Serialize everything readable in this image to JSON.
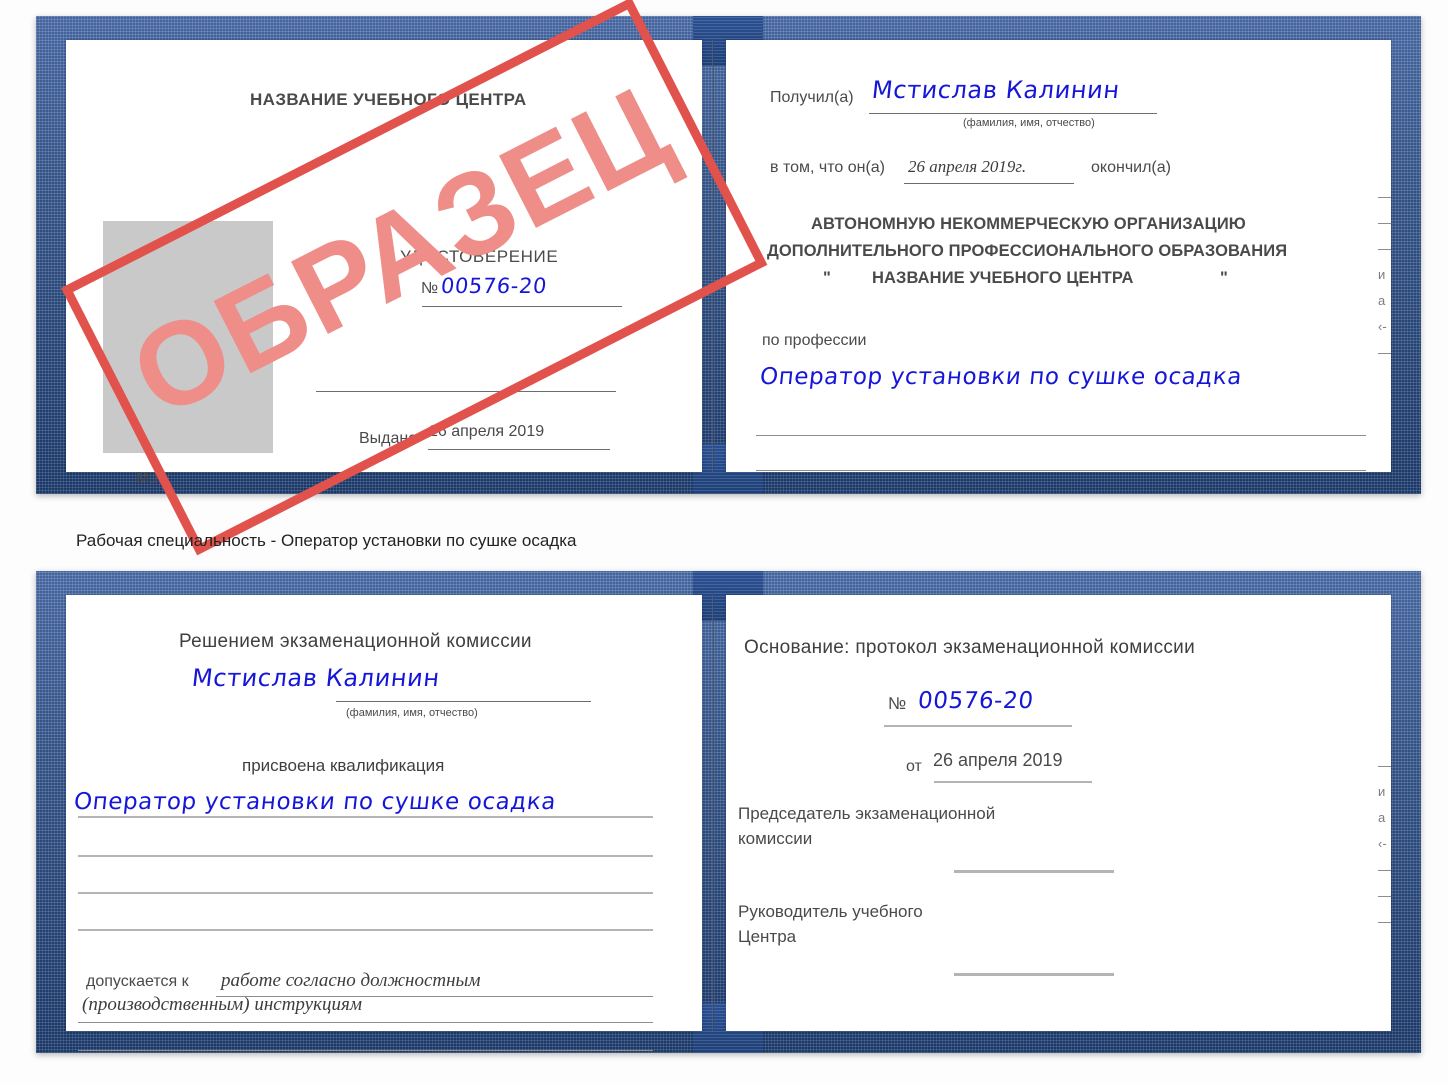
{
  "document": {
    "kind": "Удостоверение",
    "caption": "Рабочая специальность - Оператор установки по сушке осадка",
    "sample_stamp": "ОБРАЗЕЦ",
    "colors": {
      "cover_blue": "#21457f",
      "stamp_red": "#e2524d",
      "stamp_fill": "#ef8d88",
      "handwriting_blue": "#1616d8",
      "photo_placeholder": "#c9c9c9"
    }
  },
  "certificate_top": {
    "left_page": {
      "center_name": "НАЗВАНИЕ УЧЕБНОГО ЦЕНТРА",
      "title": "УДОСТОВЕРЕНИЕ",
      "number_label": "№",
      "number_value": "00576-20",
      "issued_label": "Выдано",
      "issued_value": "26 апреля 2019",
      "seal_label": "М.П."
    },
    "right_page": {
      "received_label": "Получил(а)",
      "received_value": "Мстислав Калинин",
      "received_hint": "(фамилия, имя, отчество)",
      "that_he_label": "в том, что он(а)",
      "that_he_value": "26 апреля 2019г.",
      "finished_label": "окончил(а)",
      "org_line1": "АВТОНОМНУЮ НЕКОММЕРЧЕСКУЮ ОРГАНИЗАЦИЮ",
      "org_line2": "ДОПОЛНИТЕЛЬНОГО ПРОФЕССИОНАЛЬНОГО ОБРАЗОВАНИЯ",
      "org_quote_open": "\"",
      "org_line3": "НАЗВАНИЕ УЧЕБНОГО ЦЕНТРА",
      "org_quote_close": "\"",
      "profession_label": "по профессии",
      "profession_value": "Оператор установки по сушке осадка",
      "edge_bits": [
        "—",
        "—",
        "—",
        "и",
        "а",
        "‹-",
        "—"
      ]
    }
  },
  "certificate_bottom": {
    "left_page": {
      "decision_label": "Решением экзаменационной комиссии",
      "name_value": "Мстислав Калинин",
      "name_hint": "(фамилия, имя, отчество)",
      "qualification_label": "присвоена квалификация",
      "qualification_value": "Оператор установки по сушке осадка",
      "admitted_label": "допускается к",
      "admitted_value_line1": "работе согласно должностным",
      "admitted_value_line2": "(производственным) инструкциям"
    },
    "right_page": {
      "basis_label": "Основание: протокол экзаменационной комиссии",
      "number_label": "№",
      "number_value": "00576-20",
      "date_label": "от",
      "date_value": "26 апреля 2019",
      "chairman_line1": "Председатель экзаменационной",
      "chairman_line2": "комиссии",
      "head_line1": "Руководитель учебного",
      "head_line2": "Центра",
      "edge_bits": [
        "—",
        "и",
        "а",
        "‹-",
        "—",
        "—",
        "—"
      ]
    }
  }
}
